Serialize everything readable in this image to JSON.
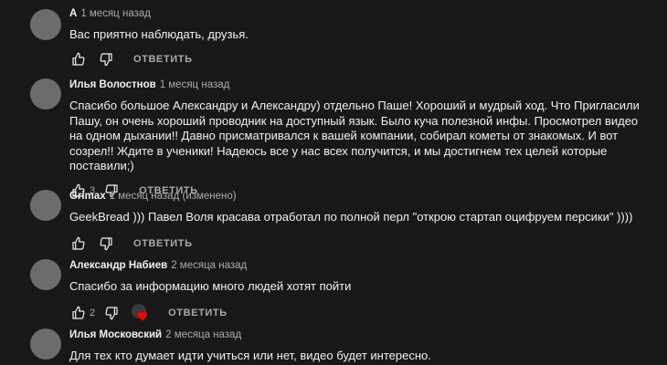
{
  "comments": [
    {
      "author": "А",
      "time": "1 месяц назад",
      "text": "Вас приятно наблюдать, друзья.",
      "likes": "",
      "reply_label": "ОТВЕТИТЬ"
    },
    {
      "author": "Илья Волостнов",
      "time": "1 месяц назад",
      "text": "Спасибо большое Александру и Александру) отдельно Паше! Хороший и мудрый ход. Что Пригласили Пашу, он очень хороший проводник на доступный язык. Было куча полезной инфы. Просмотрел видео на одном дыхании!! Давно присматривался к вашей компании, собирал кометы от знакомых. И вот созрел!! Ждите в ученики! Надеюсь все у нас всех получится, и мы достигнем тех целей которые поставили;)",
      "likes": "3",
      "reply_label": "ОТВЕТИТЬ"
    },
    {
      "author": "Grimax",
      "time": "1 месяц назад (изменено)",
      "text": "GeekBread ))) Павел Воля красава отработал по полной перл \"открою стартап оцифруем персики\" ))))",
      "likes": "",
      "reply_label": "ОТВЕТИТЬ"
    },
    {
      "author": "Александр Набиев",
      "time": "2 месяца назад",
      "text": "Спасибо за информацию много людей хотят пойти",
      "likes": "2",
      "reply_label": "ОТВЕТИТЬ",
      "creator_heart": true
    },
    {
      "author": "Илья Московский",
      "time": "2 месяца назад",
      "text": "Для тех кто думает идти учиться или нет, видео будет интересно.",
      "likes": "",
      "reply_label": ""
    }
  ],
  "colors": {
    "background": "#181818",
    "text": "#f1f1f1",
    "secondary": "#aaaaaa",
    "avatar": "#6c6c6c",
    "heart": "#ff0000"
  }
}
